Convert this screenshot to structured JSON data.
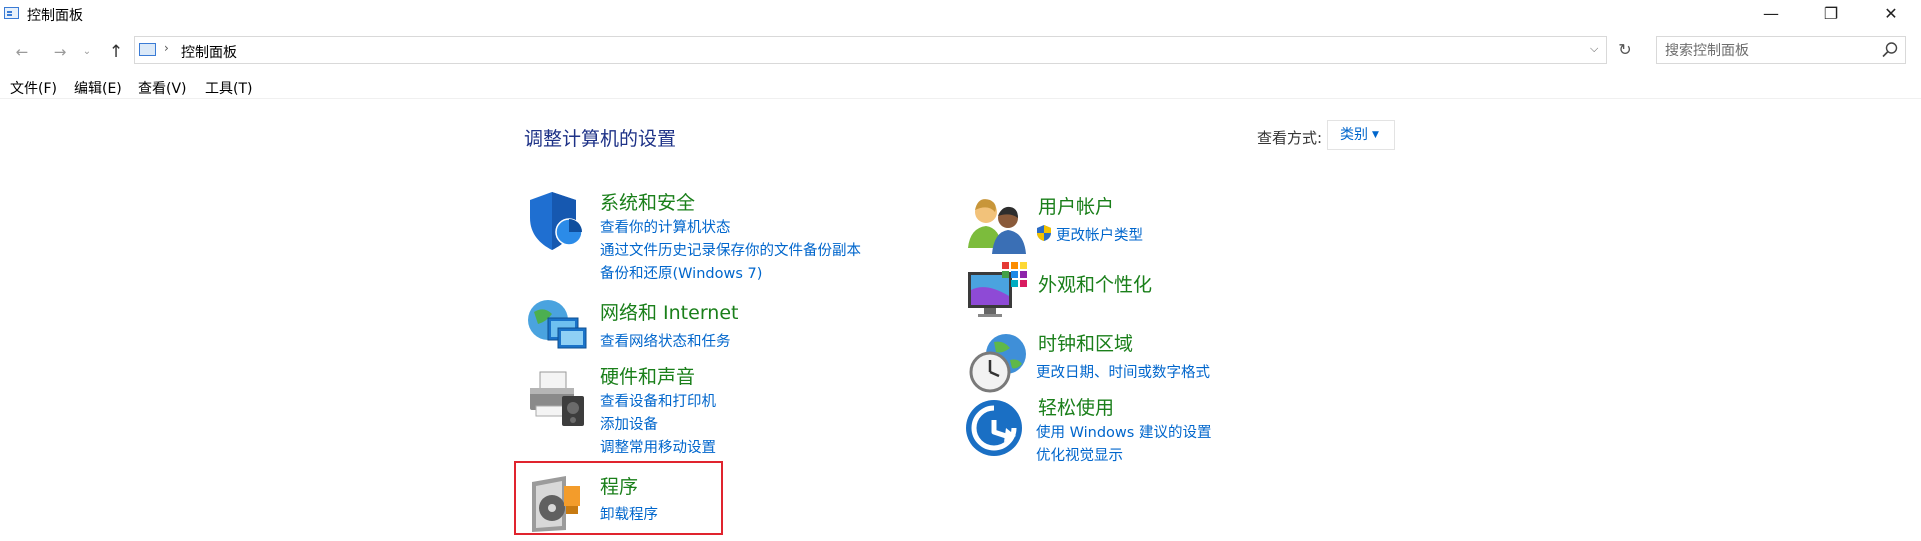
{
  "window": {
    "title": "控制面板",
    "minimize": "—",
    "maximize": "❐",
    "close": "✕"
  },
  "nav": {
    "back": "←",
    "forward": "→",
    "recent": "⌄",
    "up": "↑",
    "separator": "›",
    "dropdown": "⌵",
    "refresh": "↻"
  },
  "address": {
    "path": "控制面板"
  },
  "search": {
    "placeholder": "搜索控制面板",
    "value": ""
  },
  "menu": {
    "file": "文件(F)",
    "edit": "编辑(E)",
    "view": "查看(V)",
    "tools": "工具(T)"
  },
  "main": {
    "title": "调整计算机的设置",
    "view_by_label": "查看方式:",
    "view_by_value": "类别"
  },
  "categories": {
    "system": {
      "title": "系统和安全",
      "links": [
        "查看你的计算机状态",
        "通过文件历史记录保存你的文件备份副本",
        "备份和还原(Windows 7)"
      ]
    },
    "network": {
      "title": "网络和 Internet",
      "links": [
        "查看网络状态和任务"
      ]
    },
    "hardware": {
      "title": "硬件和声音",
      "links": [
        "查看设备和打印机",
        "添加设备",
        "调整常用移动设置"
      ]
    },
    "programs": {
      "title": "程序",
      "links": [
        "卸载程序"
      ]
    },
    "users": {
      "title": "用户帐户",
      "links": [
        "更改帐户类型"
      ]
    },
    "appearance": {
      "title": "外观和个性化",
      "links": []
    },
    "clock": {
      "title": "时钟和区域",
      "links": [
        "更改日期、时间或数字格式"
      ]
    },
    "ease": {
      "title": "轻松使用",
      "links": [
        "使用 Windows 建议的设置",
        "优化视觉显示"
      ]
    }
  },
  "colors": {
    "category_title": "#1a7f1a",
    "link": "#0066cc",
    "page_title": "#1e3287",
    "highlight": "#e0242e"
  }
}
